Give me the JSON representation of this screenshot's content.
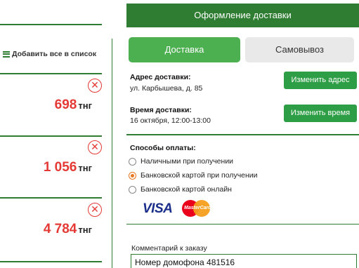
{
  "cart": {
    "add_all_label": "Добавить все в список",
    "remove_symbol": "✕",
    "items": [
      {
        "price": "698",
        "currency": "тнг"
      },
      {
        "price": "1 056",
        "currency": "тнг"
      },
      {
        "price": "4 784",
        "currency": "тнг"
      }
    ]
  },
  "checkout": {
    "title": "Оформление доставки",
    "tabs": [
      {
        "label": "Доставка",
        "active": true
      },
      {
        "label": "Самовывоз",
        "active": false
      }
    ],
    "address": {
      "label": "Адрес доставки:",
      "value": "ул. Карбышева, д. 85",
      "change_button": "Изменить адрес"
    },
    "time": {
      "label": "Время доставки:",
      "value": "16 октября, 12:00-13:00",
      "change_button": "Изменить время"
    },
    "payment": {
      "label": "Способы оплаты:",
      "options": [
        {
          "label": "Наличными при получении",
          "selected": false
        },
        {
          "label": "Банковской картой при получении",
          "selected": true
        },
        {
          "label": "Банковской картой онлайн",
          "selected": false
        }
      ],
      "card_logos": {
        "visa": "VISA",
        "mastercard": "MasterCard"
      }
    },
    "comment": {
      "label": "Комментарий к заказу",
      "value": "Номер домофона 481516"
    }
  },
  "colors": {
    "brand_green": "#2e7d32",
    "tab_active": "#4caf50",
    "button_green": "#2e9e46",
    "price_red": "#e53935",
    "radio_selected": "#e87722"
  },
  "icons": [
    "list-icon",
    "remove-circle-icon",
    "visa-logo",
    "mastercard-logo"
  ]
}
